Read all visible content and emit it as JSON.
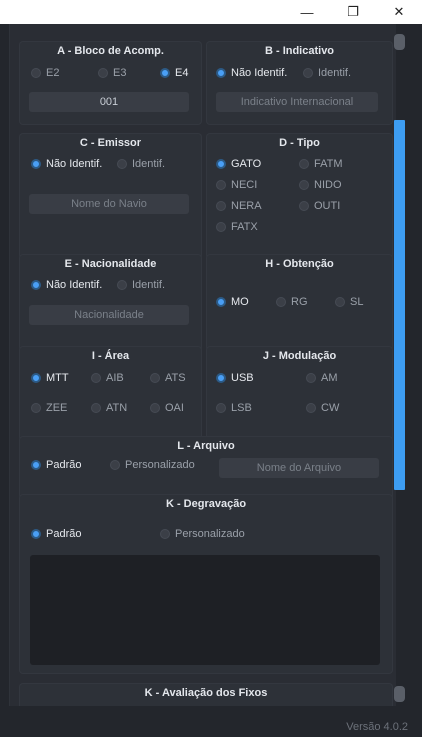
{
  "window": {
    "minimize_icon": "minimize-icon",
    "maximize_icon": "restore-icon",
    "close_icon": "close-icon",
    "minimize": "—",
    "restore": "❐",
    "close": "✕"
  },
  "sections": {
    "a": {
      "title": "A - Bloco de Acomp.",
      "options": [
        "E2",
        "E3",
        "E4"
      ],
      "selected": "E4",
      "value": "001"
    },
    "b": {
      "title": "B - Indicativo",
      "options": [
        "Não Identif.",
        "Identif."
      ],
      "selected": "Não Identif.",
      "placeholder": "Indicativo Internacional"
    },
    "c": {
      "title": "C - Emissor",
      "options": [
        "Não Identif.",
        "Identif."
      ],
      "selected": "Não Identif.",
      "placeholder": "Nome do Navio"
    },
    "d": {
      "title": "D - Tipo",
      "options": [
        "GATO",
        "FATM",
        "NECI",
        "NIDO",
        "NERA",
        "OUTI",
        "FATX"
      ],
      "selected": "GATO"
    },
    "e": {
      "title": "E - Nacionalidade",
      "options": [
        "Não Identif.",
        "Identif."
      ],
      "selected": "Não Identif.",
      "placeholder": "Nacionalidade"
    },
    "h": {
      "title": "H - Obtenção",
      "options": [
        "MO",
        "RG",
        "SL"
      ],
      "selected": "MO"
    },
    "i": {
      "title": "I - Área",
      "options": [
        "MTT",
        "AIB",
        "ATS",
        "ZEE",
        "ATN",
        "OAI"
      ],
      "selected": "MTT"
    },
    "j": {
      "title": "J - Modulação",
      "options": [
        "USB",
        "AM",
        "LSB",
        "CW"
      ],
      "selected": "USB"
    },
    "l": {
      "title": "L - Arquivo",
      "options": [
        "Padrão",
        "Personalizado"
      ],
      "selected": "Padrão",
      "placeholder": "Nome do Arquivo"
    },
    "k": {
      "title": "K - Degravação",
      "options": [
        "Padrão",
        "Personalizado"
      ],
      "selected": "Padrão"
    },
    "k2": {
      "title": "K - Avaliação dos Fixos"
    }
  },
  "colors": {
    "accent": "#4a9ff5",
    "background": "#23262c",
    "panel": "#2d3138"
  },
  "version": "Versão 4.0.2"
}
